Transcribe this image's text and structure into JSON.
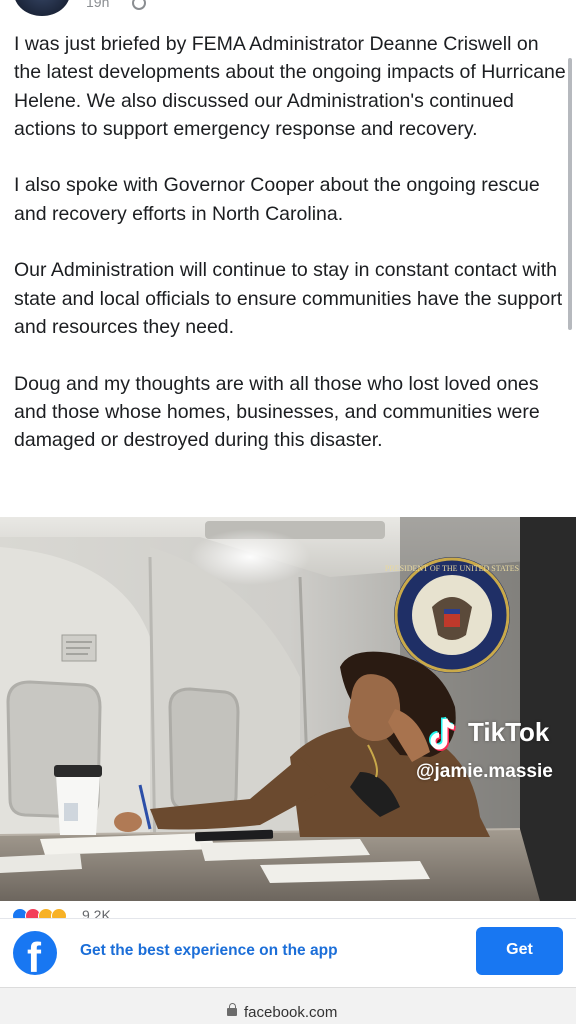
{
  "post": {
    "timestamp": "19h",
    "paragraphs": [
      "I was just briefed by FEMA Administrator Deanne Criswell on the latest developments about the ongoing impacts of Hurricane Helene. We also discussed our Administration's continued actions to support emergency response and recovery.",
      "I also spoke with Governor Cooper about the ongoing rescue and recovery efforts in North Carolina.",
      "Our Administration will continue to stay in constant contact with state and local officials to ensure communities have the support and resources they need.",
      "Doug and my thoughts are with all those who lost loved ones and those whose homes, businesses, and communities were damaged or destroyed during this disaster."
    ],
    "reaction_count": "9.2K",
    "seal_text": "PRESIDENT OF THE UNITED STATES"
  },
  "watermark": {
    "brand": "TikTok",
    "handle": "@jamie.massie"
  },
  "app_banner": {
    "message": "Get the best experience on the app",
    "button_label": "Get",
    "logo_letter": "f"
  },
  "browser": {
    "url": "facebook.com"
  },
  "colors": {
    "facebook_blue": "#1877f2",
    "link_blue": "#1b6ed8",
    "text": "#1c1e21",
    "secondary_text": "#8a8d91",
    "tiktok_cyan": "#25f4ee",
    "tiktok_red": "#fe2c55"
  }
}
